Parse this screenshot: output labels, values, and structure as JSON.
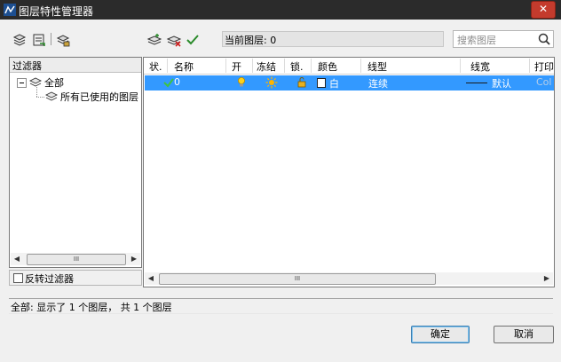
{
  "window": {
    "title": "图层特性管理器",
    "close_label": "✕"
  },
  "toolbar": {
    "current_layer_label": "当前图层: 0",
    "search_placeholder": "搜索图层"
  },
  "filter_panel": {
    "header": "过滤器",
    "tree": [
      {
        "label": "全部"
      },
      {
        "label": "所有已使用的图层"
      }
    ],
    "invert_label": "反转过滤器",
    "scroll_thumb": "III"
  },
  "layer_table": {
    "columns": [
      "状.",
      "名称",
      "开",
      "冻结",
      "锁.",
      "颜色",
      "线型",
      "线宽",
      "打印"
    ],
    "rows": [
      {
        "name": "0",
        "color": "白",
        "linetype": "连续",
        "lineweight": "默认",
        "plot_style": "Col"
      }
    ],
    "scroll_thumb": "III"
  },
  "status_text": "全部:  显示了 1 个图层，  共 1 个图层",
  "buttons": {
    "ok": "确定",
    "cancel": "取消"
  },
  "colors": {
    "selection": "#3399ff",
    "titlebar": "#2b2b2b",
    "close": "#c43b2d"
  }
}
